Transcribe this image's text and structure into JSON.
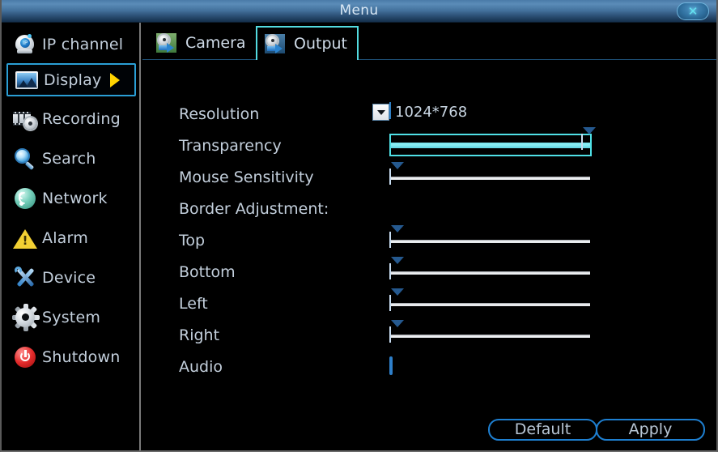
{
  "window": {
    "title": "Menu",
    "close_label": "✕",
    "close_icon": "close-icon"
  },
  "sidebar": {
    "items": [
      {
        "label": "IP channel",
        "icon": "ip-camera-icon",
        "selected": false,
        "arrow": false
      },
      {
        "label": "Display",
        "icon": "picture-icon",
        "selected": true,
        "arrow": true
      },
      {
        "label": "Recording",
        "icon": "film-gear-icon",
        "selected": false,
        "arrow": false
      },
      {
        "label": "Search",
        "icon": "magnifier-icon",
        "selected": false,
        "arrow": false
      },
      {
        "label": "Network",
        "icon": "wifi-icon",
        "selected": false,
        "arrow": false
      },
      {
        "label": "Alarm",
        "icon": "warning-icon",
        "selected": false,
        "arrow": false
      },
      {
        "label": "Device",
        "icon": "tools-icon",
        "selected": false,
        "arrow": false
      },
      {
        "label": "System",
        "icon": "gear-icon",
        "selected": false,
        "arrow": false
      },
      {
        "label": "Shutdown",
        "icon": "power-icon",
        "selected": false,
        "arrow": false
      }
    ]
  },
  "main": {
    "tabs": [
      {
        "label": "Camera",
        "icon": "camera-settings-icon",
        "active": false
      },
      {
        "label": "Output",
        "icon": "output-settings-icon",
        "active": true
      }
    ],
    "form": {
      "resolution": {
        "label": "Resolution",
        "value": "1024*768",
        "dropdown_icon": "chevron-down-icon"
      },
      "transparency": {
        "label": "Transparency",
        "value": 100,
        "min": 0,
        "max": 100,
        "focused": true
      },
      "mouse_sensitivity": {
        "label": "Mouse Sensitivity",
        "value": 0,
        "min": 0,
        "max": 100,
        "focused": false
      },
      "border_adjustment_label": "Border Adjustment:",
      "border": [
        {
          "label": "Top",
          "value": 0,
          "min": 0,
          "max": 100
        },
        {
          "label": "Bottom",
          "value": 0,
          "min": 0,
          "max": 100
        },
        {
          "label": "Left",
          "value": 0,
          "min": 0,
          "max": 100
        },
        {
          "label": "Right",
          "value": 0,
          "min": 0,
          "max": 100
        }
      ],
      "audio": {
        "label": "Audio",
        "checked": false
      }
    },
    "buttons": [
      {
        "label": "Default"
      },
      {
        "label": "Apply"
      }
    ]
  },
  "colors": {
    "accent_blue": "#2f7fc4",
    "focus_cyan": "#4fe0e6",
    "arrow_yellow": "#ffd400",
    "title_blue": "#43719c",
    "text": "#c3cfdc",
    "background": "#000000"
  }
}
